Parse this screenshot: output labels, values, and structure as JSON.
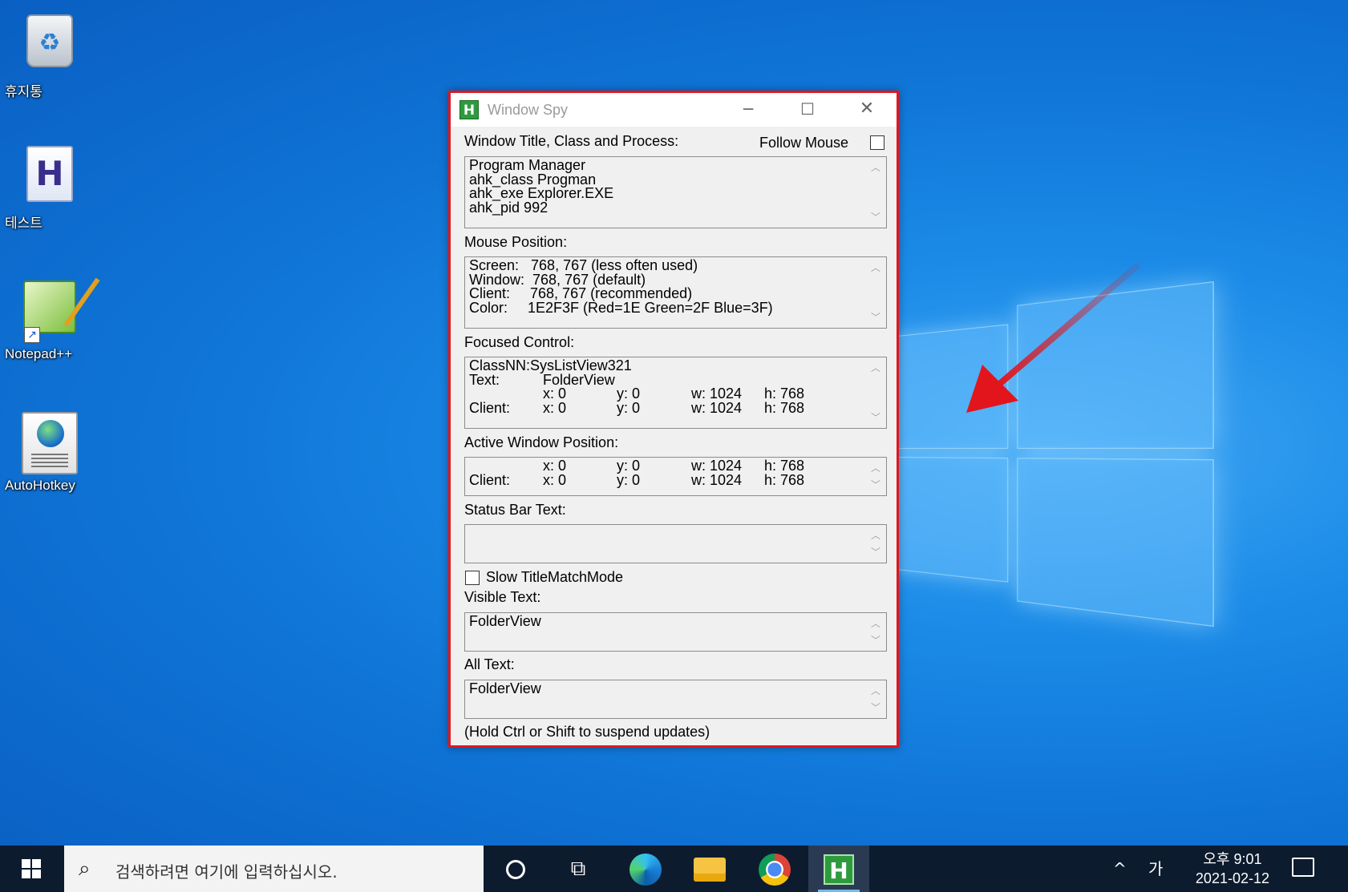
{
  "desktop": {
    "icons": [
      {
        "label": "휴지통",
        "icon": "recycle-bin-icon"
      },
      {
        "label": "테스트",
        "icon": "ahk-script-file-icon"
      },
      {
        "label": "Notepad++",
        "icon": "notepad-plus-plus-icon"
      },
      {
        "label": "AutoHotkey",
        "icon": "autohotkey-icon"
      }
    ]
  },
  "window": {
    "title": "Window Spy",
    "app_icon": "H",
    "controls": {
      "minimize": "─",
      "maximize": "☐",
      "close": "✕"
    },
    "border_color": "#e3151c"
  },
  "spy": {
    "title_class_label": "Window Title, Class and Process:",
    "follow_mouse_label": "Follow Mouse",
    "follow_mouse_checked": false,
    "title_class_text": "Program Manager\nahk_class Progman\nahk_exe Explorer.EXE\nahk_pid 992",
    "mouse_label": "Mouse Position:",
    "mouse_text": "Screen:   768, 767 (less often used)\nWindow:  768, 767 (default)\nClient:     768, 767 (recommended)\nColor:     1E2F3F (Red=1E Green=2F Blue=3F)",
    "focused_label": "Focused Control:",
    "focused": {
      "classnn": "ClassNN:SysListView321",
      "text_label": "Text:",
      "text_value": "FolderView",
      "client_label": "Client:",
      "rows": [
        {
          "x": "x: 0",
          "y": "y: 0",
          "w": "w: 1024",
          "h": "h: 768"
        },
        {
          "x": "x: 0",
          "y": "y: 0",
          "w": "w: 1024",
          "h": "h: 768"
        }
      ]
    },
    "active_label": "Active Window Position:",
    "active": {
      "client_label": "Client:",
      "rows": [
        {
          "x": "x: 0",
          "y": "y: 0",
          "w": "w: 1024",
          "h": "h: 768"
        },
        {
          "x": "x: 0",
          "y": "y: 0",
          "w": "w: 1024",
          "h": "h: 768"
        }
      ]
    },
    "status_label": "Status Bar Text:",
    "status_text": "",
    "slow_mode_label": "Slow TitleMatchMode",
    "slow_mode_checked": false,
    "visible_label": "Visible Text:",
    "visible_text": "FolderView",
    "all_label": "All Text:",
    "all_text": "FolderView",
    "footer": "(Hold Ctrl or Shift to suspend updates)"
  },
  "taskbar": {
    "search_placeholder": "검색하려면 여기에 입력하십시오.",
    "items": [
      "start-icon",
      "cortana-icon",
      "task-view-icon",
      "edge-icon",
      "file-explorer-icon",
      "chrome-icon",
      "window-spy-icon"
    ],
    "tray_chevron": "^",
    "ime": "가",
    "time": "오후 9:01",
    "date": "2021-02-12"
  },
  "annotation": {
    "arrow_color": "#e3151c"
  }
}
